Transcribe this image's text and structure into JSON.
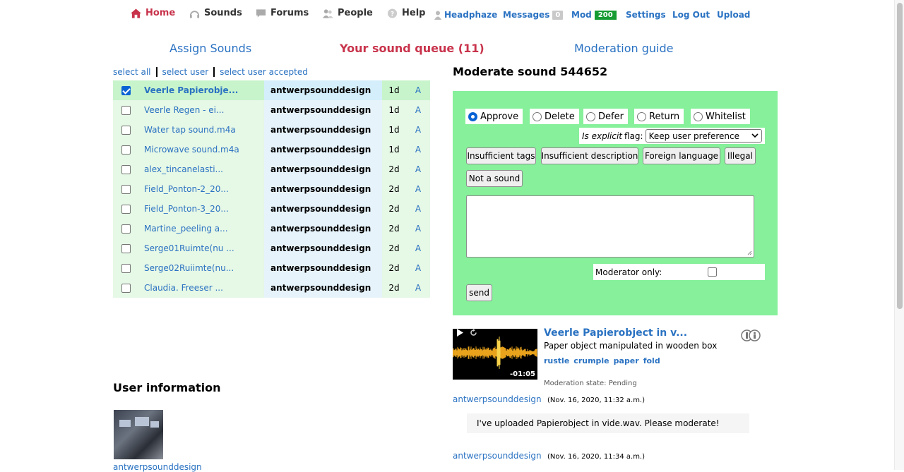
{
  "nav": {
    "home": "Home",
    "sounds": "Sounds",
    "forums": "Forums",
    "people": "People",
    "help": "Help",
    "username": "Headphaze",
    "messages": "Messages",
    "messages_count": "0",
    "mod": "Mod",
    "mod_count": "200",
    "settings": "Settings",
    "logout": "Log Out",
    "upload": "Upload"
  },
  "section_tabs": {
    "assign": "Assign Sounds",
    "queue": "Your sound queue (11)",
    "guide": "Moderation guide"
  },
  "select_links": {
    "all": "select all",
    "user": "select user",
    "user_accepted": "select user accepted"
  },
  "queue": [
    {
      "name": "Veerle Papierobje...",
      "user": "antwerpsounddesign",
      "age": "1d",
      "action": "A",
      "checked": true
    },
    {
      "name": "Veerle Regen - ei...",
      "user": "antwerpsounddesign",
      "age": "1d",
      "action": "A",
      "checked": false
    },
    {
      "name": "Water tap sound.m4a",
      "user": "antwerpsounddesign",
      "age": "1d",
      "action": "A",
      "checked": false
    },
    {
      "name": "Microwave sound.m4a",
      "user": "antwerpsounddesign",
      "age": "1d",
      "action": "A",
      "checked": false
    },
    {
      "name": "alex_tincanelasti...",
      "user": "antwerpsounddesign",
      "age": "2d",
      "action": "A",
      "checked": false
    },
    {
      "name": "Field_Ponton-2_20...",
      "user": "antwerpsounddesign",
      "age": "2d",
      "action": "A",
      "checked": false
    },
    {
      "name": "Field_Ponton-3_20...",
      "user": "antwerpsounddesign",
      "age": "2d",
      "action": "A",
      "checked": false
    },
    {
      "name": "Martine_peeling a...",
      "user": "antwerpsounddesign",
      "age": "2d",
      "action": "A",
      "checked": false
    },
    {
      "name": "Serge01Ruimte(nu ...",
      "user": "antwerpsounddesign",
      "age": "2d",
      "action": "A",
      "checked": false
    },
    {
      "name": "Serge02Ruiimte(nu...",
      "user": "antwerpsounddesign",
      "age": "2d",
      "action": "A",
      "checked": false
    },
    {
      "name": "Claudia. Freeser ...",
      "user": "antwerpsounddesign",
      "age": "2d",
      "action": "A",
      "checked": false
    }
  ],
  "user_info": {
    "heading": "User information",
    "name": "antwerpsounddesign"
  },
  "moderation": {
    "heading": "Moderate sound 544652",
    "options": [
      "Approve",
      "Delete",
      "Defer",
      "Return",
      "Whitelist"
    ],
    "selected_option": "Approve",
    "explicit_label_italic": "Is explicit",
    "explicit_label_rest": "flag:",
    "explicit_value": "Keep user preference",
    "template_buttons": [
      "Insufficient tags",
      "Insufficient description",
      "Foreign language",
      "Illegal",
      "Not a sound"
    ],
    "moderator_only_label": "Moderator only:",
    "send_label": "send"
  },
  "sound": {
    "title": "Veerle Papierobject in v...",
    "description": "Paper object manipulated in wooden box",
    "tags": [
      "rustle",
      "crumple",
      "paper",
      "fold"
    ],
    "duration": "-01:05",
    "moderation_state": "Moderation state: Pending"
  },
  "comments": [
    {
      "user": "antwerpsounddesign",
      "date": "(Nov. 16, 2020, 11:32 a.m.)",
      "text": "I've uploaded Papierobject in vide.wav. Please moderate!"
    },
    {
      "user": "antwerpsounddesign",
      "date": "(Nov. 16, 2020, 11:34 a.m.)"
    }
  ],
  "colors": {
    "accent_red": "#c8334b",
    "link_blue": "#2a72c2",
    "mod_green": "#86f09a",
    "badge_green": "#169c32"
  },
  "icons": {
    "home": "home-icon",
    "sounds": "headphones-icon",
    "forums": "speech-bubble-icon",
    "people": "people-icon",
    "help": "help-circle-icon",
    "user": "user-icon",
    "license": "creative-commons-by-icon"
  }
}
